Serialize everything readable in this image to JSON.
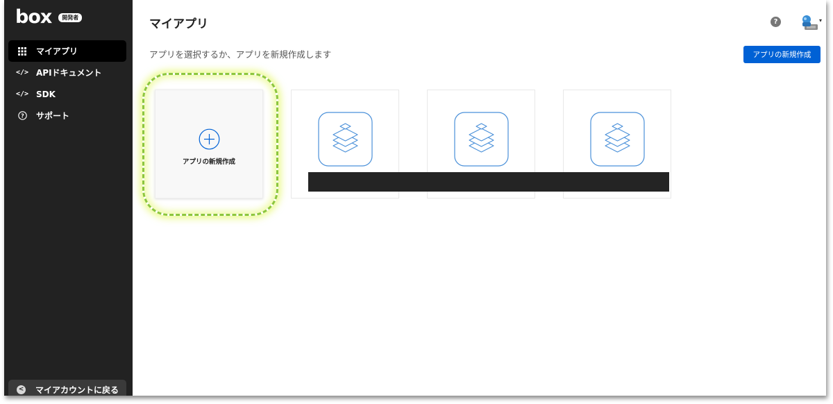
{
  "brand": {
    "logo_text": "box",
    "badge": "開発者"
  },
  "sidebar": {
    "items": [
      {
        "label": "マイアプリ",
        "icon": "grid-icon",
        "active": true
      },
      {
        "label": "APIドキュメント",
        "icon": "code-icon",
        "glyph": "</>"
      },
      {
        "label": "SDK",
        "icon": "code-icon",
        "glyph": "</>"
      },
      {
        "label": "サポート",
        "icon": "question-circle-icon",
        "glyph": "?"
      }
    ],
    "back_label": "マイアカウントに戻る",
    "back_glyph": "<"
  },
  "header": {
    "title": "マイアプリ",
    "subtitle": "アプリを選択するか、アプリを新規作成します",
    "help_glyph": "?",
    "create_button": "アプリの新規作成",
    "avatar_caret": "▾"
  },
  "cards": {
    "new_label": "アプリの新規作成",
    "apps": [
      {
        "icon": "stacked-layers-icon"
      },
      {
        "icon": "stacked-layers-icon"
      },
      {
        "icon": "stacked-layers-icon"
      }
    ]
  },
  "colors": {
    "sidebar_bg": "#222222",
    "accent_blue": "#0061d5",
    "icon_blue": "#4a90d9",
    "highlight_green": "#8cc63f"
  }
}
